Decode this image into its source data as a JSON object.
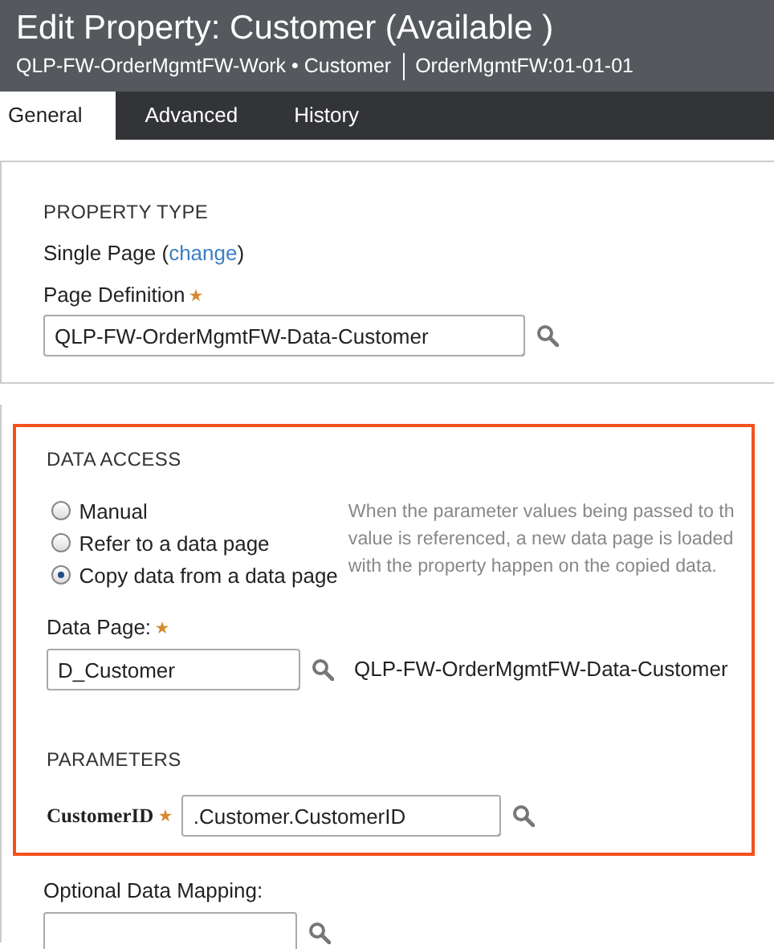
{
  "header": {
    "title": "Edit Property: Customer (Available )",
    "class_name": "QLP-FW-OrderMgmtFW-Work • Customer",
    "ruleset": "OrderMgmtFW:01-01-01"
  },
  "tabs": [
    {
      "label": "General",
      "selected": true
    },
    {
      "label": "Advanced",
      "selected": false
    },
    {
      "label": "History",
      "selected": false
    }
  ],
  "property_type": {
    "heading": "PROPERTY TYPE",
    "value": "Single Page",
    "change_open": "(",
    "change_link": "change",
    "change_close": ")",
    "page_definition_label": "Page Definition",
    "page_definition_required": true,
    "page_definition_value": "QLP-FW-OrderMgmtFW-Data-Customer"
  },
  "data_access": {
    "heading": "DATA ACCESS",
    "highlighted": true,
    "options": [
      {
        "label": "Manual",
        "selected": false
      },
      {
        "label": "Refer to a data page",
        "selected": false
      },
      {
        "label": "Copy data from a data page",
        "selected": true
      }
    ],
    "help_lines": [
      "When the parameter values being passed to th",
      "value is referenced, a new data page is loaded",
      "with the property happen on the copied data."
    ],
    "data_page_label": "Data Page:",
    "data_page_required": true,
    "data_page_value": "D_Customer",
    "data_page_class": "QLP-FW-OrderMgmtFW-Data-Customer",
    "parameters_heading": "PARAMETERS",
    "parameters": [
      {
        "name": "CustomerID",
        "required": true,
        "value": ".Customer.CustomerID"
      }
    ]
  },
  "optional_mapping": {
    "label": "Optional Data Mapping:"
  }
}
